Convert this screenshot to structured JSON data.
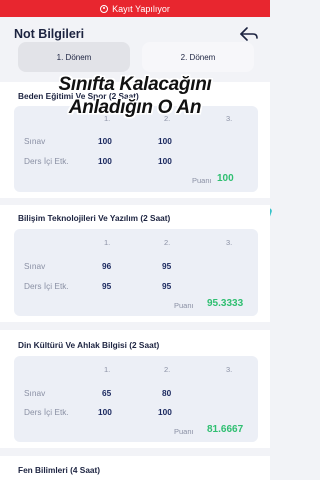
{
  "recording": {
    "label": "Kayıt Yapılıyor"
  },
  "header": {
    "title": "Not Bilgileri"
  },
  "tabs": [
    {
      "label": "1. Dönem",
      "active": true
    },
    {
      "label": "2. Dönem",
      "active": false
    }
  ],
  "overlay": {
    "line1": "Sınıfta Kalacağını",
    "line2": "Anladığın O An"
  },
  "columns": [
    "1.",
    "2.",
    "3."
  ],
  "row_labels": {
    "exam": "Sınav",
    "activity": "Ders İçi Etk.",
    "average": "Puanı"
  },
  "courses": [
    {
      "name": "Beden Eğitimi Ve Spor (2 Saat)",
      "exam": [
        "100",
        "100",
        ""
      ],
      "activity": [
        "100",
        "100",
        ""
      ],
      "average": "100"
    },
    {
      "name": "Bilişim Teknolojileri Ve Yazılım (2 Saat)",
      "exam": [
        "96",
        "95",
        ""
      ],
      "activity": [
        "95",
        "95",
        ""
      ],
      "average": "95.3333"
    },
    {
      "name": "Din Kültürü Ve Ahlak Bilgisi (2 Saat)",
      "exam": [
        "65",
        "80",
        ""
      ],
      "activity": [
        "100",
        "100",
        ""
      ],
      "average": "81.6667"
    },
    {
      "name": "Fen Bilimleri (4 Saat)"
    }
  ],
  "colors": {
    "record_bar": "#e8262f",
    "average": "#2fbf71",
    "accent": "#36c2c9",
    "value": "#1c2a60"
  }
}
